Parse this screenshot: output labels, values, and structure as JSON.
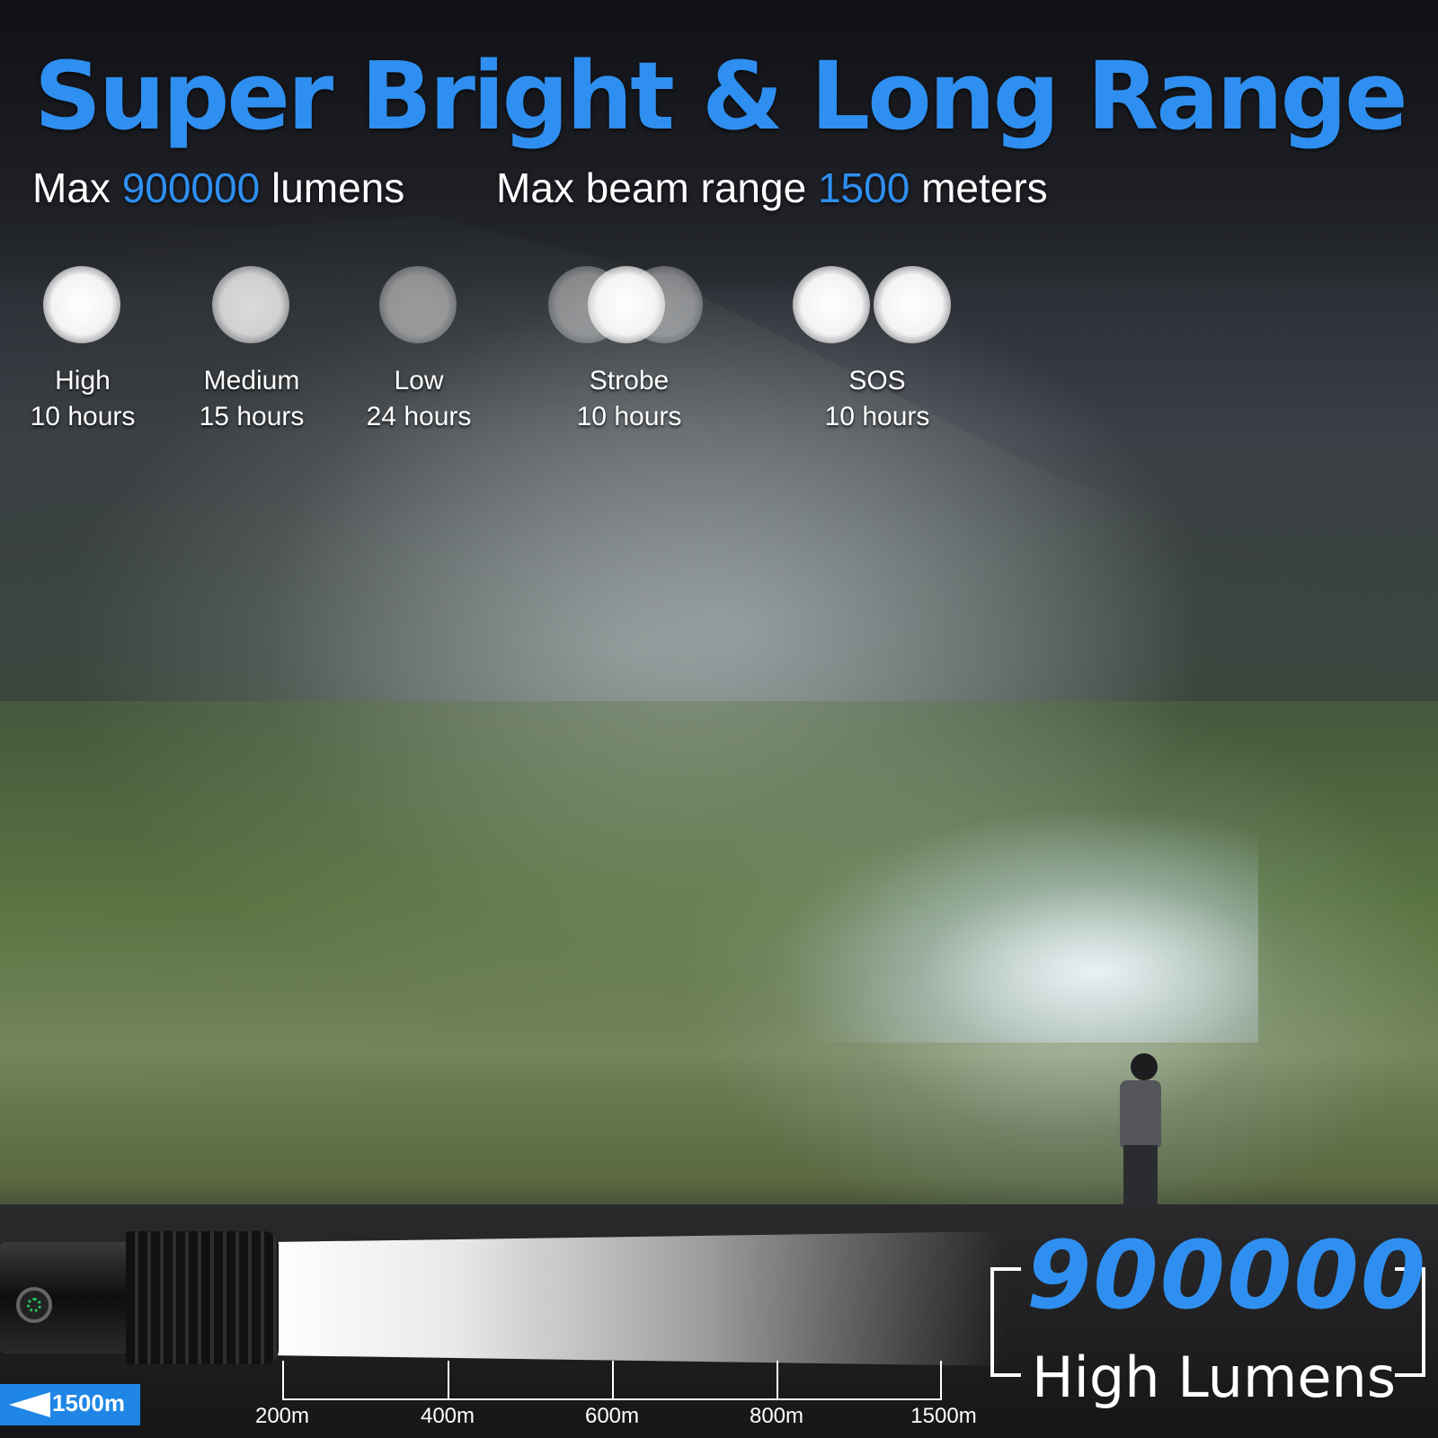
{
  "colors": {
    "accent": "#2f8ff0",
    "text": "#ffffff",
    "badge": "#1f86e6"
  },
  "headline": "Super Bright & Long Range",
  "subheadings": {
    "lumens": {
      "prefix": "Max ",
      "value": "900000",
      "suffix": " lumens"
    },
    "range": {
      "prefix": "Max beam range ",
      "value": "1500",
      "suffix": " meters"
    }
  },
  "modes": [
    {
      "name": "High",
      "time": "10 hours"
    },
    {
      "name": "Medium",
      "time": "15 hours"
    },
    {
      "name": "Low",
      "time": "24 hours"
    },
    {
      "name": "Strobe",
      "time": "10 hours"
    },
    {
      "name": "SOS",
      "time": "10 hours"
    }
  ],
  "distance_scale": {
    "badge": "1500m",
    "ticks": [
      "200m",
      "400m",
      "600m",
      "800m",
      "1500m"
    ]
  },
  "lumens_callout": {
    "value": "900000",
    "caption": "High Lumens"
  },
  "icons": {
    "beam_badge": "flashlight-beam-icon",
    "power_button": "power-button-icon"
  }
}
